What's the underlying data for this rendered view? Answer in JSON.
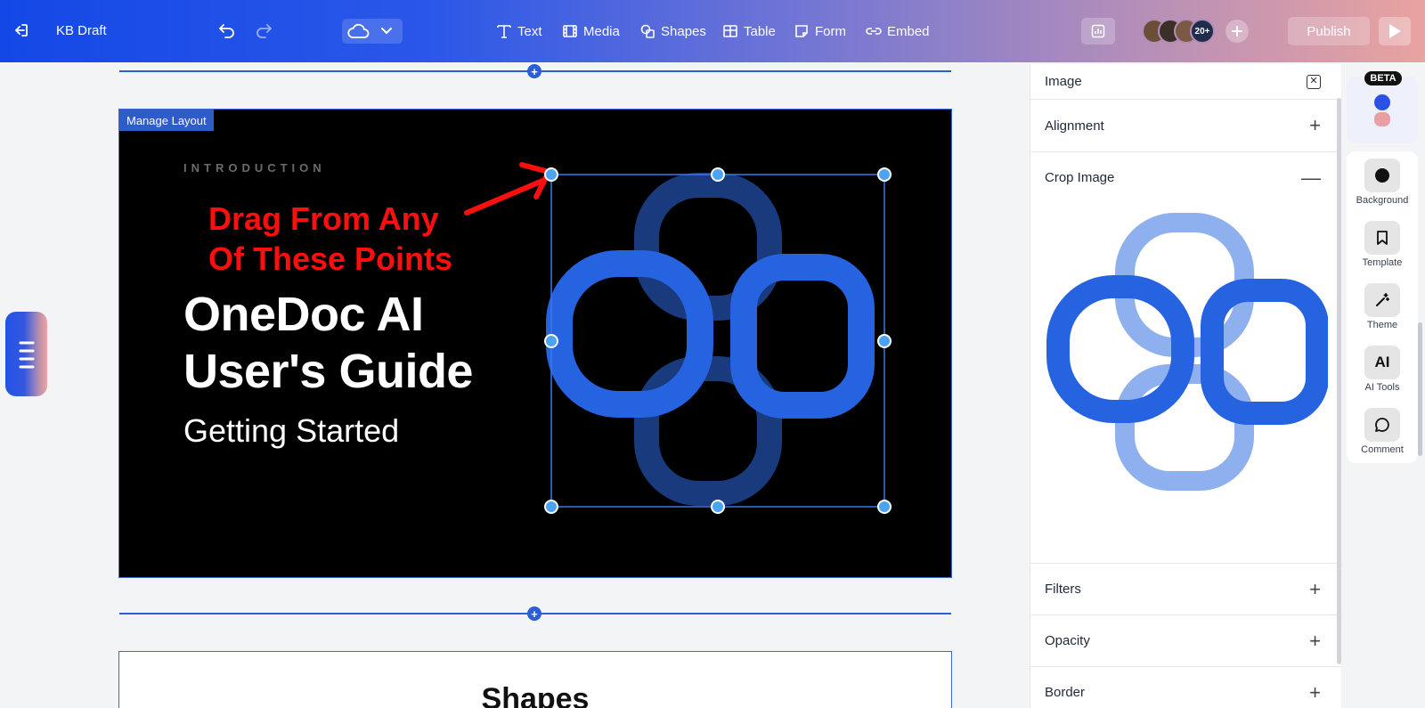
{
  "topbar": {
    "doc_title": "KB Draft",
    "tools": [
      "Text",
      "Media",
      "Shapes",
      "Table",
      "Form",
      "Embed"
    ],
    "collaborator_count": "20+",
    "publish_label": "Publish"
  },
  "slide": {
    "manage_layout": "Manage Layout",
    "eyebrow": "INTRODUCTION",
    "annotation_line1": "Drag From Any",
    "annotation_line2": "Of These Points",
    "title_line1": "OneDoc AI",
    "title_line2": "User's Guide",
    "subtitle": "Getting Started"
  },
  "next_section": {
    "heading": "Shapes"
  },
  "panel": {
    "title": "Image",
    "sections": {
      "alignment": "Alignment",
      "crop": "Crop Image",
      "filters": "Filters",
      "opacity": "Opacity",
      "border": "Border"
    }
  },
  "rail": {
    "beta": "BETA",
    "items": [
      "Background",
      "Template",
      "Theme",
      "AI Tools",
      "Comment"
    ],
    "ai_glyph": "AI"
  },
  "colors": {
    "accent": "#2a5fd8",
    "annotation": "#ff0e0e",
    "logo_bright": "#2563e0",
    "logo_dim": "#1a3a7e",
    "logo_light": "#8fb0ee"
  }
}
